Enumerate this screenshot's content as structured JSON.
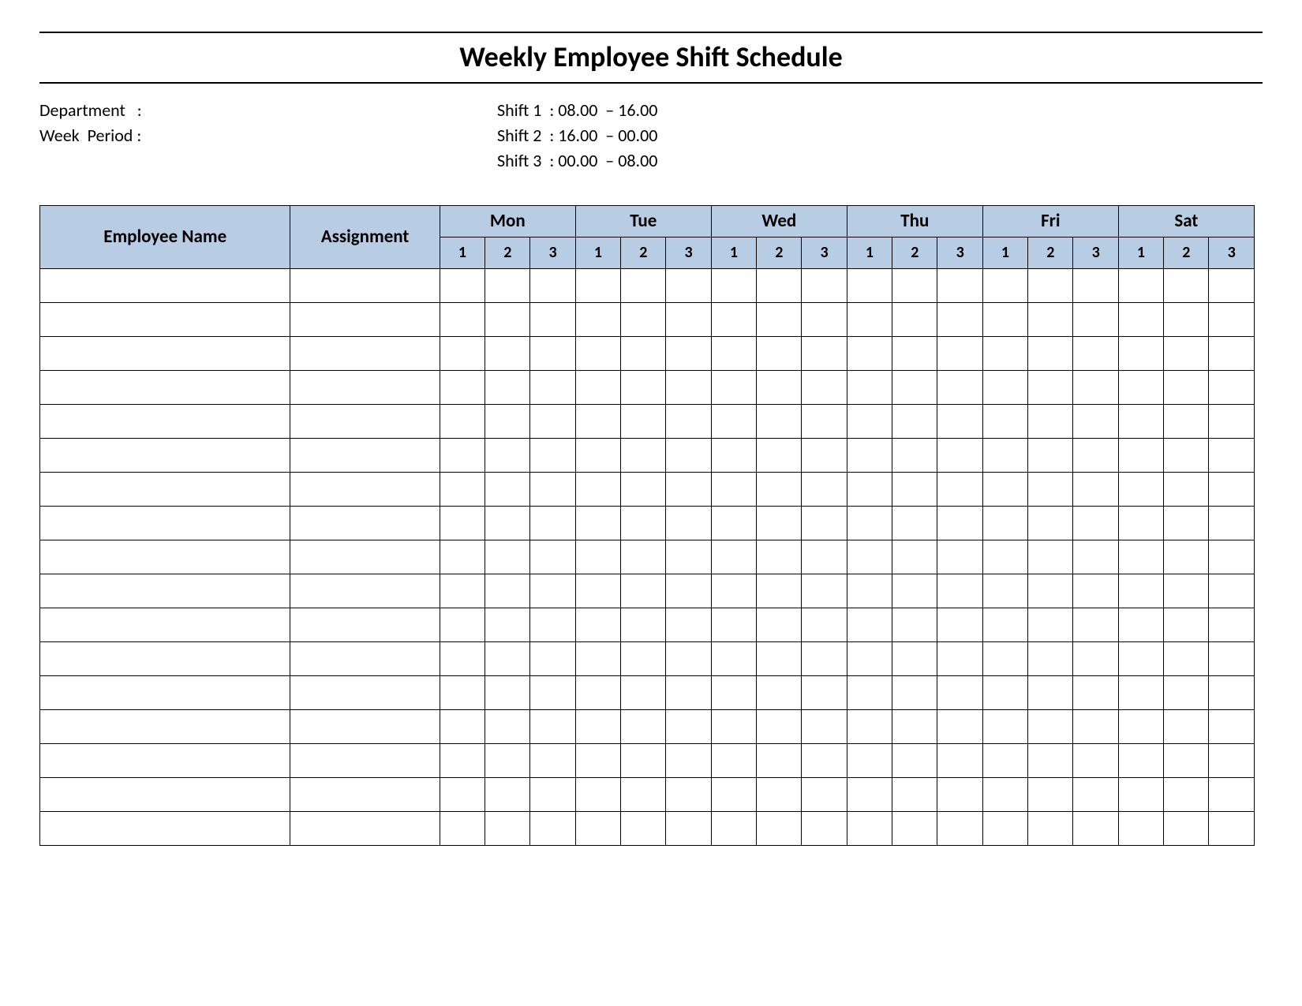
{
  "title": "Weekly Employee Shift Schedule",
  "meta": {
    "department_label": "Department   :",
    "department_value": "",
    "week_period_label": "Week  Period :",
    "week_period_value": "",
    "shift1_label": "Shift 1  :",
    "shift1_value": " 08.00  – 16.00",
    "shift2_label": "Shift 2  :",
    "shift2_value": " 16.00  – 00.00",
    "shift3_label": "Shift 3  :",
    "shift3_value": " 00.00  – 08.00"
  },
  "table": {
    "employee_name_header": "Employee Name",
    "assignment_header": "Assignment",
    "days": [
      "Mon",
      "Tue",
      "Wed",
      "Thu",
      "Fri",
      "Sat"
    ],
    "shift_numbers": [
      "1",
      "2",
      "3"
    ],
    "row_count": 17
  }
}
